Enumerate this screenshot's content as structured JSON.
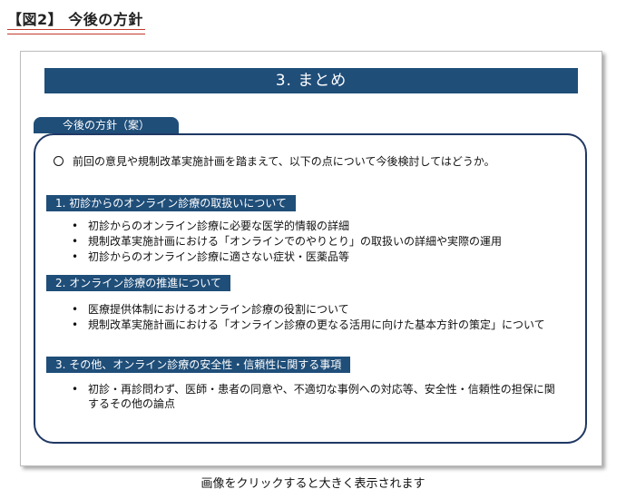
{
  "figure": {
    "title": "【図2】 今後の方針"
  },
  "slide": {
    "banner": "3. まとめ",
    "tab_label": "今後の方針（案）",
    "intro": "前回の意見や規制改革実施計画を踏まえて、以下の点について今後検討してはどうか。",
    "sections": [
      {
        "heading": "1. 初診からのオンライン診療の取扱いについて",
        "items": [
          "初診からのオンライン診療に必要な医学的情報の詳細",
          "規制改革実施計画における「オンラインでのやりとり」の取扱いの詳細や実際の運用",
          "初診からのオンライン診療に適さない症状・医薬品等"
        ]
      },
      {
        "heading": "2. オンライン診療の推進について",
        "items": [
          "医療提供体制におけるオンライン診療の役割について",
          "規制改革実施計画における「オンライン診療の更なる活用に向けた基本方針の策定」について"
        ]
      },
      {
        "heading": "3. その他、オンライン診療の安全性・信頼性に関する事項",
        "items": [
          "初診・再診問わず、医師・患者の同意や、不適切な事例への対応等、安全性・信頼性の担保に関するその他の論点"
        ]
      }
    ]
  },
  "caption": "画像をクリックすると大きく表示されます",
  "colors": {
    "navy": "#1f4e79",
    "panel_border": "#1f3864",
    "title_underline": "#c0392b"
  }
}
